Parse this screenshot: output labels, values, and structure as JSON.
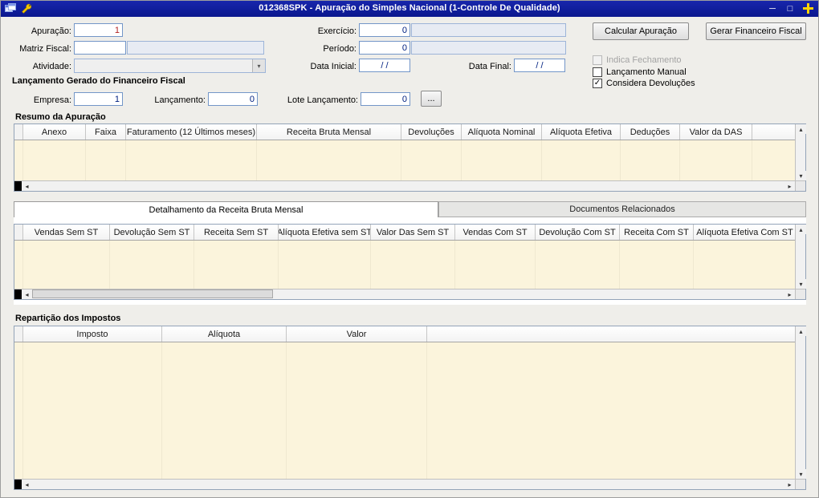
{
  "titlebar": {
    "title": "012368SPK - Apuração do Simples Nacional (1-Controle De Qualidade)",
    "minimize_glyph": "─",
    "maximize_glyph": "□"
  },
  "form": {
    "apuracao_label": "Apuração:",
    "apuracao_value": "1",
    "matriz_label": "Matriz Fiscal:",
    "matriz_value": "",
    "atividade_label": "Atividade:",
    "atividade_value": "",
    "exercicio_label": "Exercício:",
    "exercicio_value": "0",
    "periodo_label": "Período:",
    "periodo_value": "0",
    "data_inicial_label": "Data Inicial:",
    "data_inicial_value": "/ /",
    "data_final_label": "Data Final:",
    "data_final_value": "/ /",
    "calcular_button": "Calcular Apuração",
    "gerar_button": "Gerar Financeiro Fiscal",
    "checkboxes": [
      {
        "label": "Indica Fechamento",
        "checked": false,
        "disabled": true
      },
      {
        "label": "Lançamento Manual",
        "checked": false,
        "disabled": false
      },
      {
        "label": "Considera Devoluções",
        "checked": true,
        "disabled": false
      }
    ]
  },
  "lancamento": {
    "section_title": "Lançamento Gerado do Financeiro Fiscal",
    "empresa_label": "Empresa:",
    "empresa_value": "1",
    "lancamento_label": "Lançamento:",
    "lancamento_value": "0",
    "lote_label": "Lote Lançamento:",
    "lote_value": "0",
    "browse_button": "..."
  },
  "resumo": {
    "title": "Resumo da Apuração",
    "columns": [
      "Anexo",
      "Faixa",
      "Faturamento (12 Últimos meses)",
      "Receita Bruta Mensal",
      "Devoluções",
      "Alíquota Nominal",
      "Alíquota Efetiva",
      "Deduções",
      "Valor da DAS"
    ],
    "rows": []
  },
  "tabs": {
    "detalhamento": "Detalhamento da Receita Bruta Mensal",
    "documentos": "Documentos Relacionados"
  },
  "detalhamento": {
    "columns": [
      "Vendas Sem ST",
      "Devolução Sem ST",
      "Receita Sem ST",
      "Alíquota Efetiva sem ST",
      "Valor Das Sem ST",
      "Vendas Com ST",
      "Devolução Com ST",
      "Receita Com ST",
      "Alíquota Efetiva Com ST"
    ],
    "rows": []
  },
  "reparticao": {
    "title": "Repartição dos Impostos",
    "columns": [
      "Imposto",
      "Alíquota",
      "Valor"
    ],
    "rows": []
  },
  "icons": {
    "check": "✓",
    "dropdown": "▾",
    "scroll_up": "▴",
    "scroll_down": "▾",
    "scroll_left": "◂",
    "scroll_right": "▸"
  },
  "colors": {
    "titlebar": "#0A178E",
    "accent_close": "#FFD400",
    "grid_body": "#FBF4DC",
    "input_border": "#7396C8",
    "value_text": "#002080",
    "apuracao_value_text": "#B22222"
  }
}
